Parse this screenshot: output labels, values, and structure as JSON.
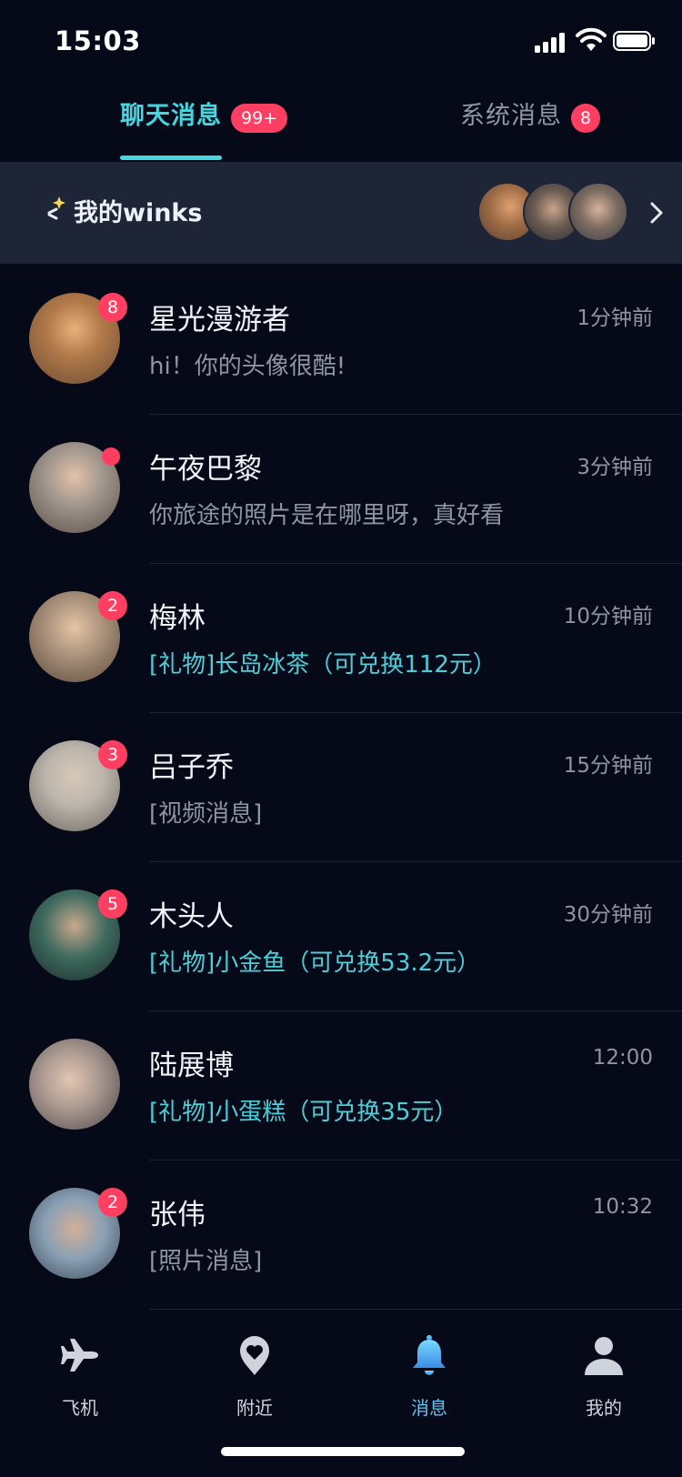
{
  "status_bar": {
    "time": "15:03"
  },
  "tabs": [
    {
      "label": "聊天消息",
      "badge": "99+",
      "active": true
    },
    {
      "label": "系统消息",
      "badge": "8",
      "active": false
    }
  ],
  "winks": {
    "label": "我的winks"
  },
  "conversations": [
    {
      "name": "星光漫游者",
      "time": "1分钟前",
      "preview": "hi！你的头像很酷!",
      "unread": "8",
      "preview_type": "text",
      "avatar_color": "#c58d5d"
    },
    {
      "name": "午夜巴黎",
      "time": "3分钟前",
      "preview": "你旅途的照片是在哪里呀，真好看",
      "unread": "",
      "dot": true,
      "preview_type": "text",
      "avatar_color": "#7a7f88"
    },
    {
      "name": "梅林",
      "time": "10分钟前",
      "preview": "[礼物]长岛冰茶（可兑换112元）",
      "unread": "2",
      "preview_type": "gift",
      "avatar_color": "#8c7660"
    },
    {
      "name": "吕子乔",
      "time": "15分钟前",
      "preview": "[视频消息]",
      "unread": "3",
      "preview_type": "text",
      "avatar_color": "#a8a49c"
    },
    {
      "name": "木头人",
      "time": "30分钟前",
      "preview": "[礼物]小金鱼（可兑换53.2元）",
      "unread": "5",
      "preview_type": "gift",
      "avatar_color": "#335a52"
    },
    {
      "name": "陆展博",
      "time": "12:00",
      "preview": "[礼物]小蛋糕（可兑换35元）",
      "unread": "",
      "preview_type": "gift",
      "avatar_color": "#9b8f8c"
    },
    {
      "name": "张伟",
      "time": "10:32",
      "preview": "[照片消息]",
      "unread": "2",
      "preview_type": "text",
      "avatar_color": "#6e8aa6"
    }
  ],
  "nav": [
    {
      "label": "飞机",
      "icon": "airplane-icon",
      "active": false
    },
    {
      "label": "附近",
      "icon": "location-heart-icon",
      "active": false
    },
    {
      "label": "消息",
      "icon": "bell-icon",
      "active": true
    },
    {
      "label": "我的",
      "icon": "person-icon",
      "active": false
    }
  ],
  "colors": {
    "accent": "#45d6df",
    "badge": "#ff3f62",
    "gift_text": "#4ccdd8",
    "background": "#060a18",
    "banner": "#1d2536"
  }
}
